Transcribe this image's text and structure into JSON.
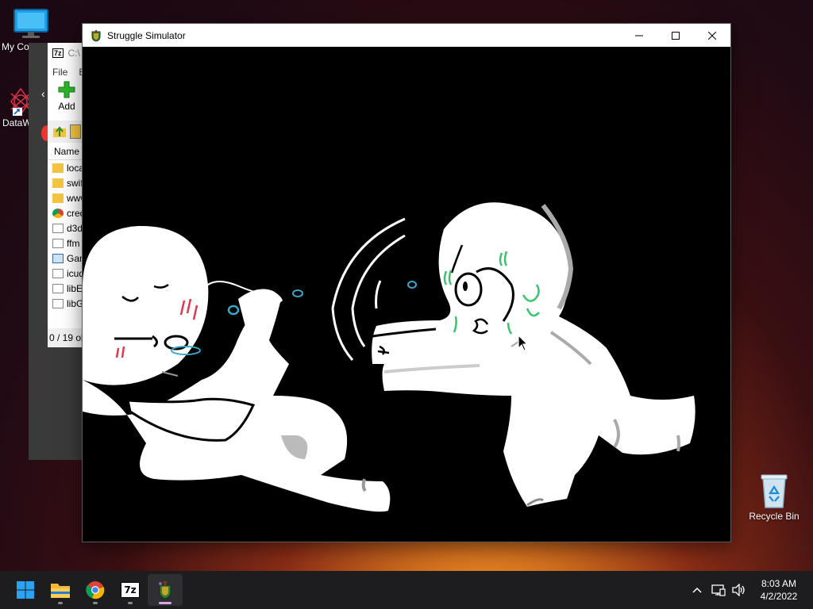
{
  "desktop": {
    "icons": [
      {
        "label": "My Co",
        "icon": "monitor-icon"
      },
      {
        "label": "DataW",
        "icon": "datawrapper-icon"
      },
      {
        "label": "Recycle Bin",
        "icon": "recycle-bin-icon"
      }
    ]
  },
  "zip_window": {
    "title": "C:\\",
    "menu": [
      "File",
      "E"
    ],
    "toolbar_add": "Add",
    "column_name": "Name",
    "rows": [
      "loca",
      "swif",
      "www",
      "cred",
      "d3d",
      "ffm",
      "Gam",
      "icud",
      "libE",
      "libG"
    ],
    "status": "0 / 19 ob"
  },
  "game_window": {
    "title": "Struggle Simulator",
    "minimize_icon": "minimize-icon",
    "maximize_icon": "maximize-icon",
    "close_icon": "close-icon"
  },
  "taskbar": {
    "apps": [
      "start-icon",
      "file-explorer-icon",
      "chrome-icon",
      "7zip-icon",
      "struggle-simulator-icon"
    ],
    "time": "8:03 AM",
    "date": "4/2/2022"
  },
  "colors": {
    "taskbar_bg": "#1d1d1f",
    "active_indicator": "#d9a6e8",
    "sweat_green": "#38c46a",
    "tear_blue": "#3aa7c9",
    "blush_red": "#e0394f"
  }
}
